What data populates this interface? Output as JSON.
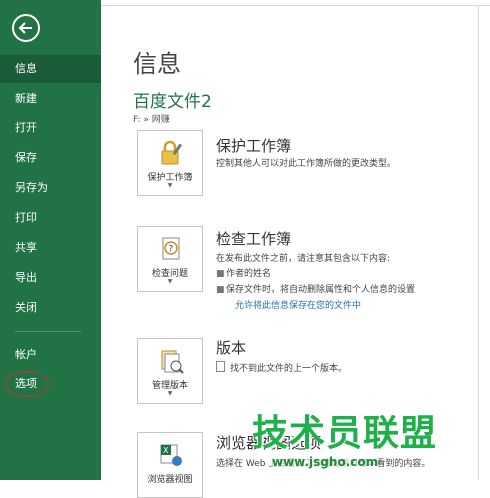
{
  "sidebar": {
    "items": [
      {
        "label": "信息"
      },
      {
        "label": "新建"
      },
      {
        "label": "打开"
      },
      {
        "label": "保存"
      },
      {
        "label": "另存为"
      },
      {
        "label": "打印"
      },
      {
        "label": "共享"
      },
      {
        "label": "导出"
      },
      {
        "label": "关闭"
      },
      {
        "label": "帐户"
      },
      {
        "label": "选项"
      }
    ]
  },
  "main": {
    "title": "信息",
    "doc_name": "百度文件2",
    "doc_path": "F: » 网赚",
    "sections": [
      {
        "tile_label": "保护工作簿",
        "title": "保护工作簿",
        "desc": "控制其他人可以对此工作簿所做的更改类型。"
      },
      {
        "tile_label": "检查问题",
        "title": "检查工作簿",
        "desc": "在发布此文件之前，请注意其包含以下内容:",
        "bullets": [
          "作者的姓名",
          "保存文件时，将自动删除属性和个人信息的设置"
        ],
        "link": "允许将此信息保存在您的文件中"
      },
      {
        "tile_label": "管理版本",
        "title": "版本",
        "desc": "找不到此文件的上一个版本。"
      },
      {
        "tile_label": "浏览器视图",
        "title": "浏览器视图选项",
        "desc": "选择在 Web 上查看此工作簿时用户可以看到的内容。"
      }
    ]
  },
  "watermark": {
    "text": "技术员联盟",
    "url": "www.jsgho.com"
  },
  "colors": {
    "sidebar": "#217346",
    "sidebar_active": "#1a5c38",
    "accent": "#217346",
    "watermark": "#1fb04a"
  }
}
